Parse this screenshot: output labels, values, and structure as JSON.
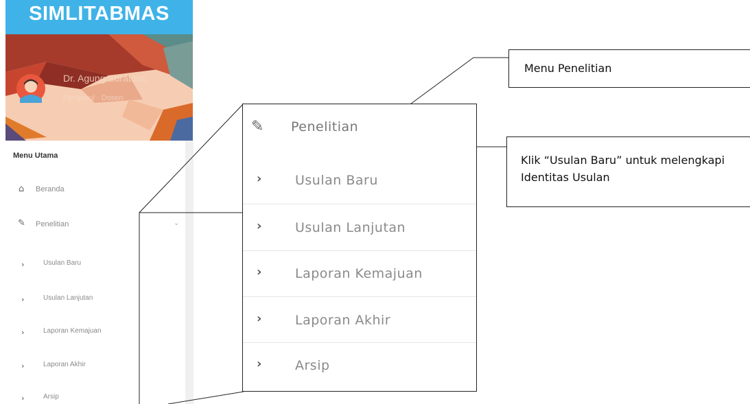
{
  "sidebar": {
    "app_title": "SIMLITABMAS",
    "user_name": "Dr. Agung Suratono",
    "user_role": "Pengusul · Dosen",
    "menu_header": "Menu Utama",
    "items": [
      {
        "icon": "home-icon",
        "label": "Beranda"
      },
      {
        "icon": "edit-icon",
        "label": "Penelitian",
        "expanded": true
      }
    ],
    "submenu": [
      {
        "label": "Usulan Baru"
      },
      {
        "label": "Usulan Lanjutan"
      },
      {
        "label": "Laporan Kemajuan"
      },
      {
        "label": "Laporan Akhir"
      },
      {
        "label": "Arsip"
      }
    ]
  },
  "zoom": {
    "header_label": "Penelitian",
    "items": [
      {
        "label": "Usulan Baru"
      },
      {
        "label": "Usulan Lanjutan"
      },
      {
        "label": "Laporan Kemajuan"
      },
      {
        "label": "Laporan Akhir"
      },
      {
        "label": "Arsip"
      }
    ]
  },
  "callouts": {
    "menu": "Menu Penelitian",
    "usulan": "Klik “Usulan Baru” untuk melengkapi Identitas Usulan"
  },
  "colors": {
    "brand_bar": "#3fb3e8"
  }
}
